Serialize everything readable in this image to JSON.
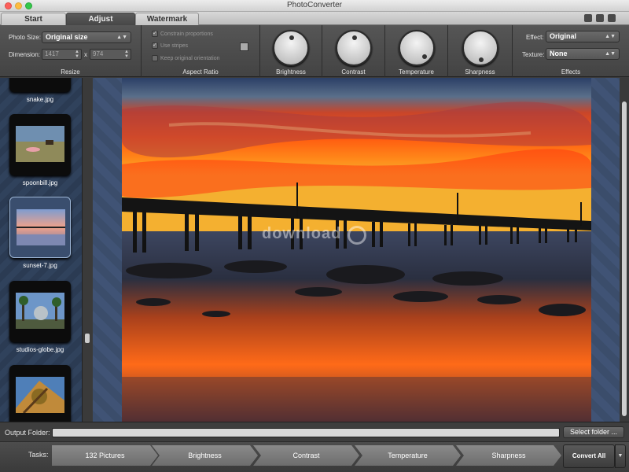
{
  "window": {
    "title": "PhotoConverter"
  },
  "tabs": [
    {
      "label": "Start",
      "active": false
    },
    {
      "label": "Adjust",
      "active": true
    },
    {
      "label": "Watermark",
      "active": false
    }
  ],
  "resize": {
    "photo_size_label": "Photo Size:",
    "photo_size_value": "Original size",
    "dimension_label": "Dimension:",
    "width": "1417",
    "x_sep": "x",
    "height": "974",
    "section_label": "Resize"
  },
  "aspect": {
    "constrain": "Constrain proportions",
    "stripes": "Use stripes",
    "orientation": "Keep original orientation",
    "section_label": "Aspect Ratio"
  },
  "knobs": [
    {
      "label": "Brightness"
    },
    {
      "label": "Contrast"
    },
    {
      "label": "Temperature"
    },
    {
      "label": "Sharpness"
    }
  ],
  "effects": {
    "effect_label": "Effect:",
    "effect_value": "Original",
    "texture_label": "Texture:",
    "texture_value": "None",
    "section_label": "Effects"
  },
  "thumbnails": [
    {
      "name": "snake.jpg",
      "selected": false
    },
    {
      "name": "spoonbill.jpg",
      "selected": false
    },
    {
      "name": "sunset-7.jpg",
      "selected": true
    },
    {
      "name": "studios-globe.jpg",
      "selected": false
    },
    {
      "name": "",
      "selected": false
    }
  ],
  "watermark_text": "download",
  "output": {
    "label": "Output Folder:",
    "value": "",
    "button": "Select folder ..."
  },
  "tasks": {
    "label": "Tasks:",
    "items": [
      "132 Pictures",
      "Brightness",
      "Contrast",
      "Temperature",
      "Sharpness"
    ],
    "convert": "Convert All"
  },
  "colors": {
    "accent_sky": "#ff5a1a",
    "panel": "#4a4a4a",
    "sidebar": "#2d3e57"
  }
}
